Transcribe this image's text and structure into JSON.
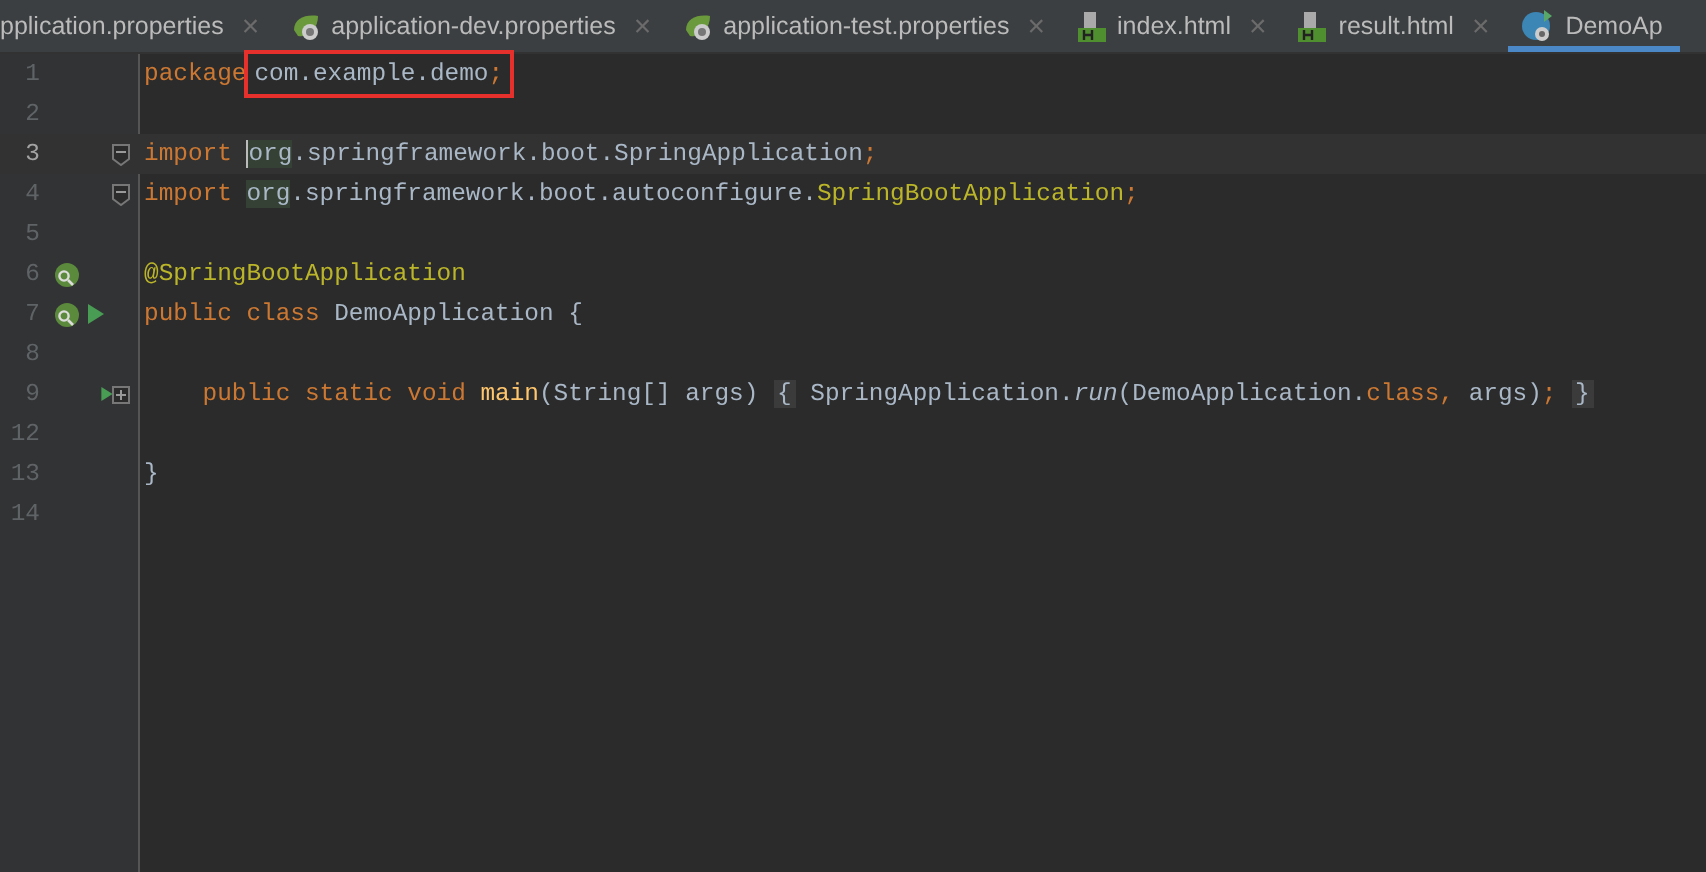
{
  "tabs": [
    {
      "label": "pplication.properties",
      "kind": "plain",
      "close": "×",
      "selected": false
    },
    {
      "label": "application-dev.properties",
      "kind": "spring",
      "close": "×",
      "selected": false
    },
    {
      "label": "application-test.properties",
      "kind": "spring",
      "close": "×",
      "selected": false
    },
    {
      "label": "index.html",
      "kind": "html",
      "close": "×",
      "selected": false
    },
    {
      "label": "result.html",
      "kind": "html",
      "close": "×",
      "selected": false
    },
    {
      "label": "DemoAp",
      "kind": "java",
      "selected": true
    }
  ],
  "lines": [
    {
      "number": "1",
      "current": false,
      "tokens": [
        {
          "kind": "keyword",
          "text": "package"
        },
        {
          "kind": "box",
          "tokens": [
            {
              "kind": "plain",
              "text": "com.example.demo"
            },
            {
              "kind": "keyword",
              "text": ";"
            }
          ]
        }
      ]
    },
    {
      "number": "2",
      "current": false
    },
    {
      "number": "3",
      "current": true,
      "folded": false,
      "tokens": [
        {
          "kind": "keyword",
          "text": "import "
        },
        {
          "kind": "usage",
          "text": "org",
          "caret": true
        },
        {
          "kind": "plain",
          "text": ".springframework.boot.SpringApplication"
        },
        {
          "kind": "keyword",
          "text": ";"
        }
      ]
    },
    {
      "number": "4",
      "current": false,
      "folded": false,
      "tokens": [
        {
          "kind": "keyword",
          "text": "import "
        },
        {
          "kind": "usage",
          "text": "org"
        },
        {
          "kind": "plain",
          "text": ".springframework.boot.autoconfigure."
        },
        {
          "kind": "annotation",
          "text": "SpringBootApplication"
        },
        {
          "kind": "keyword",
          "text": ";"
        }
      ]
    },
    {
      "number": "5",
      "current": false
    },
    {
      "number": "6",
      "current": false,
      "markers": [
        {
          "kind": "bean"
        }
      ],
      "tokens": [
        {
          "kind": "annotation",
          "text": "@SpringBootApplication"
        }
      ]
    },
    {
      "number": "7",
      "current": false,
      "markers": [
        {
          "kind": "spring"
        },
        {
          "kind": "run"
        }
      ],
      "tokens": [
        {
          "kind": "keyword",
          "text": "public class "
        },
        {
          "kind": "plain",
          "text": "DemoApplication {"
        }
      ]
    },
    {
      "number": "8",
      "current": false
    },
    {
      "number": "9",
      "current": false,
      "markers": [
        {
          "kind": "run"
        }
      ],
      "folded": true,
      "tokens": [
        {
          "kind": "keyword",
          "text": "    public static void "
        },
        {
          "kind": "method",
          "text": "main"
        },
        {
          "kind": "plain",
          "text": "(String[] args) "
        },
        {
          "kind": "brace",
          "text": "{"
        },
        {
          "kind": "plain",
          "text": " SpringApplication."
        },
        {
          "kind": "italic",
          "text": "run"
        },
        {
          "kind": "plain",
          "text": "(DemoApplication."
        },
        {
          "kind": "keyword",
          "text": "class, "
        },
        {
          "kind": "plain",
          "text": "args)"
        },
        {
          "kind": "keyword",
          "text": "; "
        },
        {
          "kind": "brace",
          "text": "}"
        }
      ]
    },
    {
      "number": "12",
      "current": false
    },
    {
      "number": "13",
      "current": false,
      "tokens": [
        {
          "kind": "plain",
          "text": "}"
        }
      ]
    },
    {
      "number": "14",
      "current": false
    }
  ]
}
